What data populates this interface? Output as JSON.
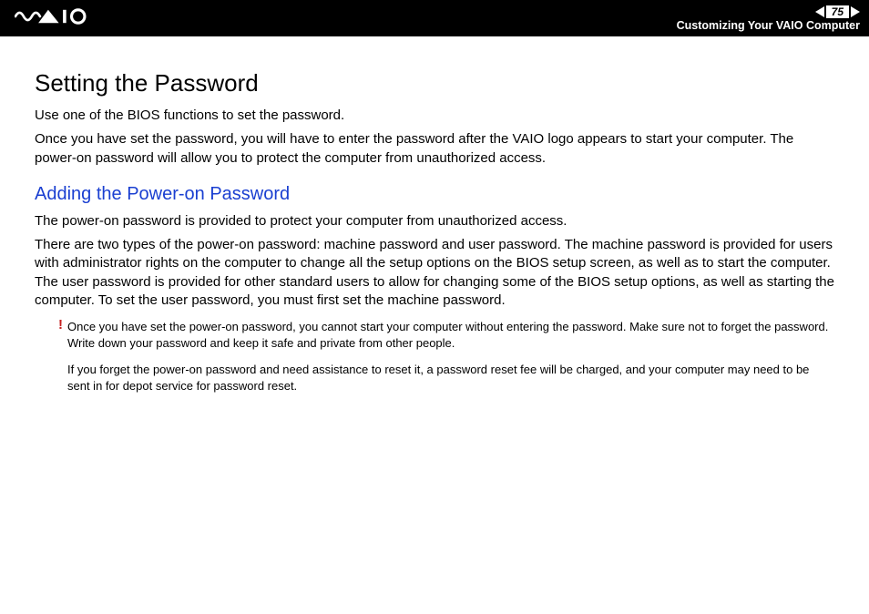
{
  "header": {
    "page_number": "75",
    "breadcrumb": "Customizing Your VAIO Computer"
  },
  "content": {
    "title": "Setting the Password",
    "intro1": "Use one of the BIOS functions to set the password.",
    "intro2": "Once you have set the password, you will have to enter the password after the VAIO logo appears to start your computer. The power-on password will allow you to protect the computer from unauthorized access.",
    "subtitle": "Adding the Power-on Password",
    "p1": "The power-on password is provided to protect your computer from unauthorized access.",
    "p2": "There are two types of the power-on password: machine password and user password. The machine password is provided for users with administrator rights on the computer to change all the setup options on the BIOS setup screen, as well as to start the computer. The user password is provided for other standard users to allow for changing some of the BIOS setup options, as well as starting the computer. To set the user password, you must first set the machine password.",
    "note1": "Once you have set the power-on password, you cannot start your computer without entering the password. Make sure not to forget the password. Write down your password and keep it safe and private from other people.",
    "note2": "If you forget the power-on password and need assistance to reset it, a password reset fee will be charged, and your computer may need to be sent in for depot service for password reset.",
    "bang": "!"
  }
}
